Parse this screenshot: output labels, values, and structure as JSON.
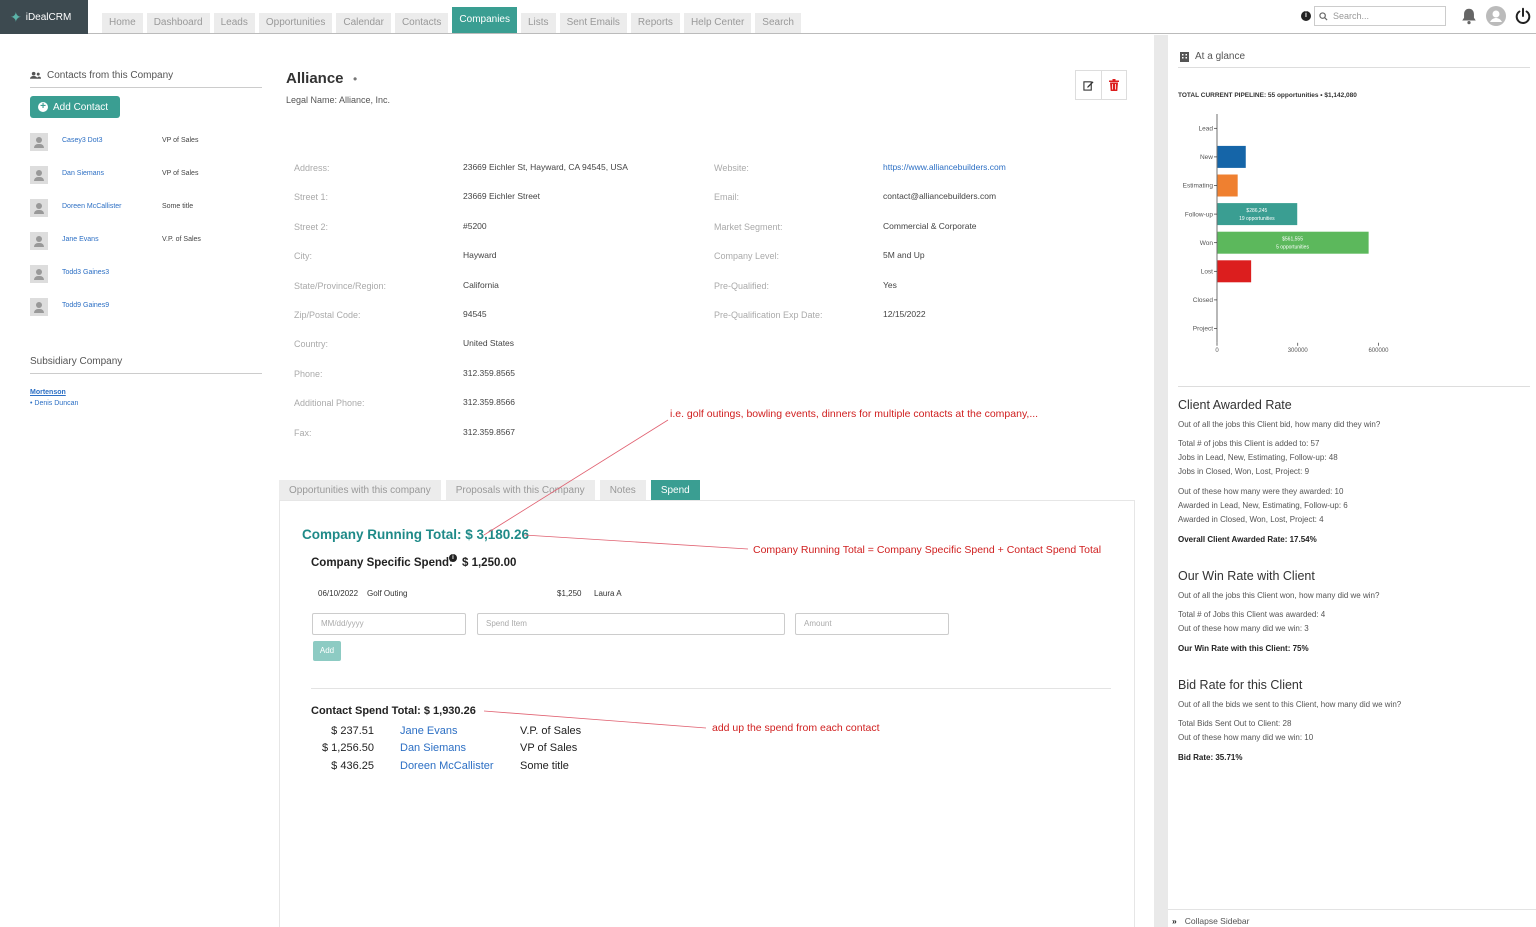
{
  "app": {
    "name": "iDealCRM"
  },
  "nav": {
    "tabs": [
      "Home",
      "Dashboard",
      "Leads",
      "Opportunities",
      "Calendar",
      "Contacts",
      "Companies",
      "Lists",
      "Sent Emails",
      "Reports",
      "Help Center",
      "Search"
    ],
    "active": "Companies",
    "search_placeholder": "Search..."
  },
  "left": {
    "contacts_title": "Contacts from this Company",
    "add_contact_label": "Add Contact",
    "contacts": [
      {
        "name": "Casey3 Dot3",
        "title": "VP of Sales"
      },
      {
        "name": "Dan Siemans",
        "title": "VP of Sales"
      },
      {
        "name": "Doreen McCallister",
        "title": "Some title"
      },
      {
        "name": "Jane Evans",
        "title": "V.P. of Sales"
      },
      {
        "name": "Todd3 Gaines3",
        "title": ""
      },
      {
        "name": "Todd9 Gaines9",
        "title": ""
      }
    ],
    "subsidiary_title": "Subsidiary Company",
    "subsidiary_name": "Mortenson",
    "subsidiary_person": "Denis Duncan"
  },
  "company": {
    "name": "Alliance",
    "legal_name": "Legal Name: Alliance, Inc.",
    "fields_left": [
      {
        "label": "Address:",
        "value": "23669 Eichler St, Hayward, CA 94545, USA"
      },
      {
        "label": "Street 1:",
        "value": "23669 Eichler Street"
      },
      {
        "label": "Street 2:",
        "value": "#5200"
      },
      {
        "label": "City:",
        "value": "Hayward"
      },
      {
        "label": "State/Province/Region:",
        "value": "California"
      },
      {
        "label": "Zip/Postal Code:",
        "value": "94545"
      },
      {
        "label": "Country:",
        "value": "United States"
      },
      {
        "label": "Phone:",
        "value": "312.359.8565"
      },
      {
        "label": "Additional Phone:",
        "value": "312.359.8566"
      },
      {
        "label": "Fax:",
        "value": "312.359.8567"
      }
    ],
    "fields_right": [
      {
        "label": "Website:",
        "value": "https://www.alliancebuilders.com"
      },
      {
        "label": "Email:",
        "value": "contact@alliancebuilders.com"
      },
      {
        "label": "Market Segment:",
        "value": "Commercial & Corporate"
      },
      {
        "label": "Company Level:",
        "value": "5M and Up"
      },
      {
        "label": "Pre-Qualified:",
        "value": "Yes"
      },
      {
        "label": "Pre-Qualification Exp Date:",
        "value": "12/15/2022"
      }
    ]
  },
  "tabs": [
    "Opportunities with this company",
    "Proposals with this Company",
    "Notes",
    "Spend"
  ],
  "spend": {
    "running_total": "Company Running Total: $ 3,180.26",
    "specific_label": "Company Specific Spend:",
    "specific_amount": "$ 1,250.00",
    "item": {
      "date": "06/10/2022",
      "name": "Golf Outing",
      "amount": "$1,250",
      "person": "Laura A"
    },
    "date_placeholder": "MM/dd/yyyy",
    "item_placeholder": "Spend Item",
    "amount_placeholder": "Amount",
    "add_label": "Add",
    "contact_total": "Contact Spend Total: $ 1,930.26",
    "contact_rows": [
      {
        "amount": "$ 237.51",
        "name": "Jane Evans",
        "title": "V.P. of Sales"
      },
      {
        "amount": "$ 1,256.50",
        "name": "Dan Siemans",
        "title": "VP of Sales"
      },
      {
        "amount": "$ 436.25",
        "name": "Doreen McCallister",
        "title": "Some title"
      }
    ]
  },
  "annotations": {
    "golf": "i.e. golf outings, bowling events, dinners for multiple contacts at the company,...",
    "running": "Company Running Total = Company Specific Spend + Contact Spend Total",
    "contact": "add up the spend from each contact",
    "color": "#d02020"
  },
  "sidebar": {
    "glance_title": "At a glance",
    "pipeline": "TOTAL CURRENT PIPELINE: 55 opportunities • $1,142,080",
    "awarded": {
      "title": "Client Awarded Rate",
      "lines": [
        "Out of all the jobs this Client bid, how many did they win?",
        "Total # of jobs this Client is added to: 57",
        "Jobs in Lead, New, Estimating, Follow-up: 48",
        "Jobs in Closed, Won, Lost, Project: 9",
        "Out of these how many were they awarded: 10",
        "Awarded in Lead, New, Estimating, Follow-up: 6",
        "Awarded in Closed, Won, Lost, Project: 4"
      ],
      "result": "Overall Client Awarded Rate: 17.54%"
    },
    "win": {
      "title": "Our Win Rate with Client",
      "lines": [
        "Out of all the jobs this Client won, how many did we win?",
        "Total # of Jobs this Client was awarded: 4",
        "Out of these how many did we win: 3"
      ],
      "result": "Our Win Rate with this Client: 75%"
    },
    "bid": {
      "title": "Bid Rate for this Client",
      "lines": [
        "Out of all the bids we sent to this Client, how many did we win?",
        "Total Bids Sent Out to Client: 28",
        "Out of these how many did we win: 10"
      ],
      "result": "Bid Rate: 35.71%"
    },
    "collapse_label": "Collapse Sidebar"
  },
  "chart_data": {
    "type": "bar",
    "orientation": "horizontal",
    "categories": [
      "Lead",
      "New",
      "Estimating",
      "Follow-up",
      "Won",
      "Lost",
      "Closed",
      "Project"
    ],
    "values": [
      0,
      105000,
      75000,
      296245,
      561555,
      125000,
      0,
      0
    ],
    "colors": [
      "#1565a8",
      "#1565a8",
      "#ef8030",
      "#3a9e92",
      "#5cb85c",
      "#dc1e1e",
      "#1565a8",
      "#1565a8"
    ],
    "data_labels": [
      "",
      "",
      "",
      "$286,245\n19 opportunities",
      "$561,555\n5 opportunities",
      "",
      "",
      ""
    ],
    "xticks": [
      0,
      300000,
      600000
    ],
    "xlim": [
      0,
      680000
    ]
  }
}
